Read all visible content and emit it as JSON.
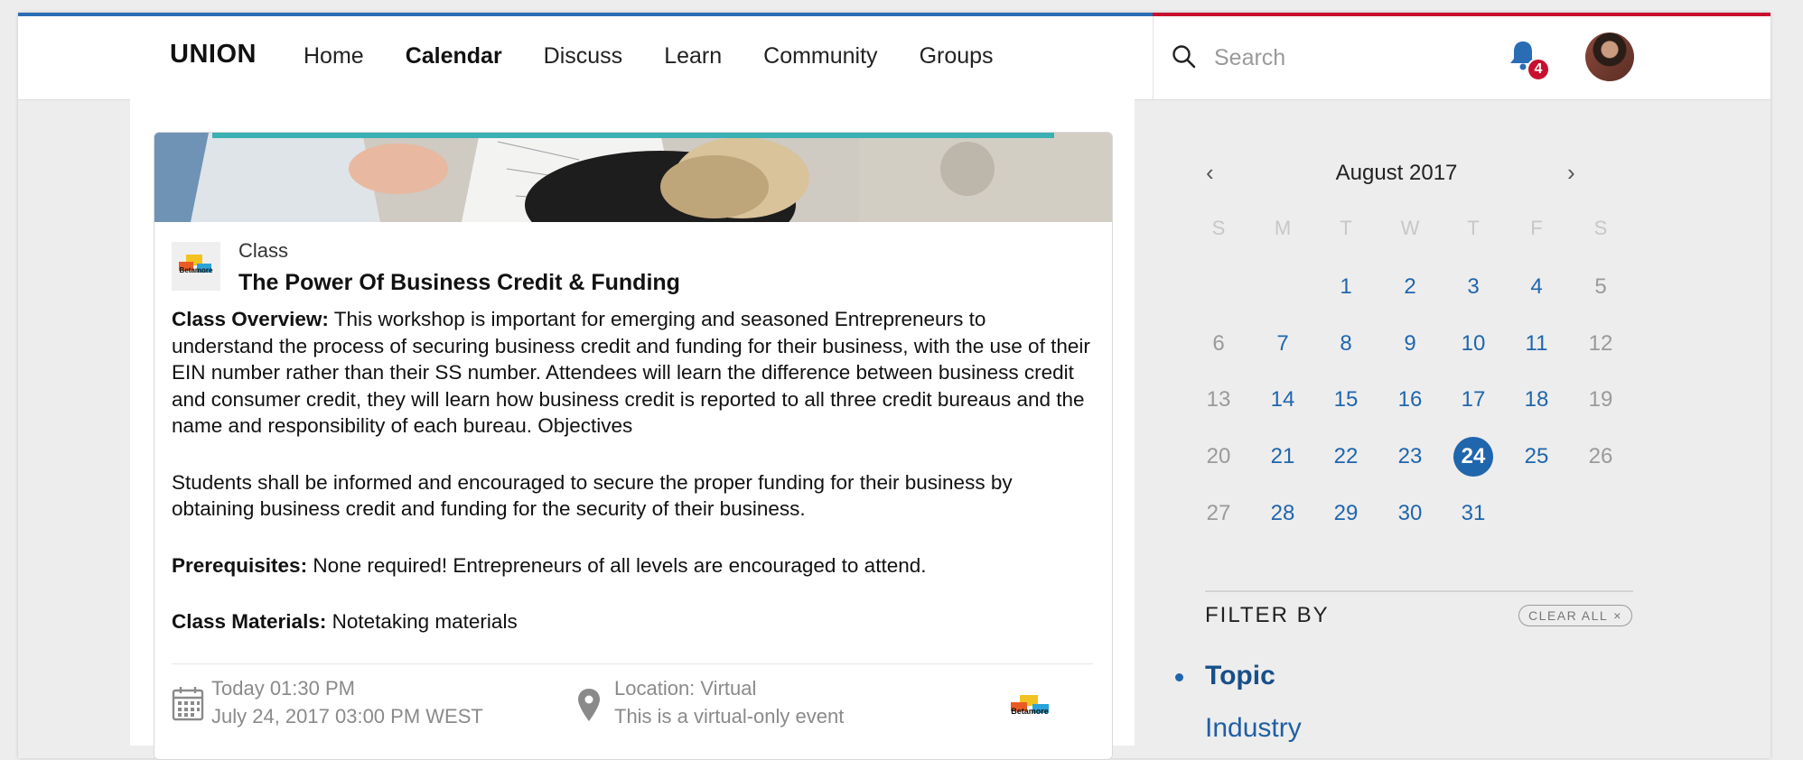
{
  "colors": {
    "accent_blue": "#2a6db5",
    "accent_red": "#c8102e",
    "link_blue": "#1f66ad",
    "teal": "#3ab0b3"
  },
  "header": {
    "logo": "UNION",
    "nav": [
      {
        "label": "Home",
        "active": false
      },
      {
        "label": "Calendar",
        "active": true
      },
      {
        "label": "Discuss",
        "active": false
      },
      {
        "label": "Learn",
        "active": false
      },
      {
        "label": "Community",
        "active": false
      },
      {
        "label": "Groups",
        "active": false
      }
    ],
    "search_placeholder": "Search",
    "notification_count": "4",
    "icons": {
      "search": "search-icon",
      "notifications": "bell-icon",
      "avatar": "user-avatar"
    }
  },
  "event": {
    "type": "Class",
    "title": "The Power Of Business Credit & Funding",
    "overview_label": "Class Overview:",
    "overview_text": " This workshop is important for emerging and seasoned Entrepreneurs to understand the process of securing business credit and funding for their business, with the use of their EIN number rather than their SS number. Attendees will learn the difference between business credit and consumer credit, they will learn how business credit is reported to all three credit bureaus and the name and responsibility of each bureau. Objectives",
    "students_text": "Students shall be informed and encouraged to secure the proper funding for their business by obtaining business credit and funding for the security of their business.",
    "prereq_label": "Prerequisites:",
    "prereq_text": " None required! Entrepreneurs of all levels are encouraged to attend.",
    "materials_label": "Class Materials:",
    "materials_text": " Notetaking materials",
    "time_start": "Today 01:30 PM",
    "time_end": "July 24, 2017 03:00 PM WEST",
    "location": "Location: Virtual",
    "location_note": "This is a virtual-only event",
    "logo_text": "Betamore",
    "icons": {
      "calendar": "calendar-icon",
      "location": "map-pin-icon"
    }
  },
  "calendar": {
    "title": "August 2017",
    "prev": "‹",
    "next": "›",
    "weekdays": [
      "S",
      "M",
      "T",
      "W",
      "T",
      "F",
      "S"
    ],
    "first_weekday_index": 2,
    "days_in_month": 31,
    "selected_day": 24
  },
  "filters": {
    "title": "FILTER BY",
    "clear_all": "CLEAR ALL",
    "clear_icon": "×",
    "items": [
      {
        "label": "Topic",
        "active": true
      },
      {
        "label": "Industry",
        "active": false
      }
    ]
  }
}
